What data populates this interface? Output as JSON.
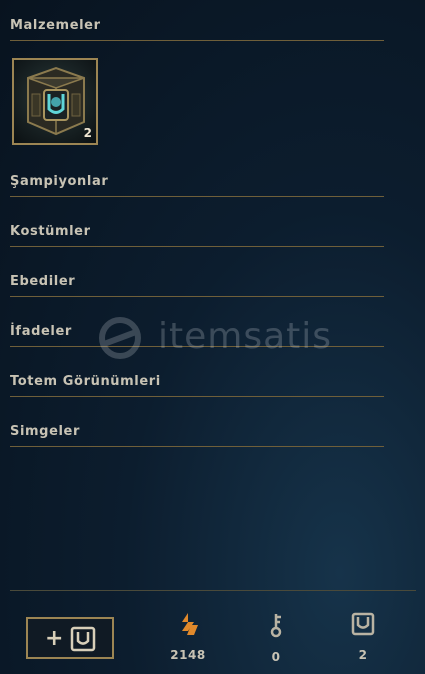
{
  "sections": {
    "materials": "Malzemeler",
    "champions": "Şampiyonlar",
    "skins": "Kostümler",
    "eternals": "Ebediler",
    "emotes": "İfadeler",
    "ward_skins": "Totem Görünümleri",
    "icons": "Simgeler"
  },
  "materials_items": [
    {
      "icon": "hextech-chest-icon",
      "count": "2"
    }
  ],
  "watermark": {
    "text": "itemsatis",
    "icon": "itemsatis-logo-icon"
  },
  "footer": {
    "add_button_plus": "+",
    "add_button_icon": "key-fragment-shield-icon",
    "currencies": [
      {
        "icon": "orange-essence-icon",
        "value": "2148",
        "color": "#e0892b"
      },
      {
        "icon": "key-icon",
        "value": "0",
        "color": "#b9b3a3"
      },
      {
        "icon": "chest-shield-icon",
        "value": "2",
        "color": "#b9b3a3"
      }
    ]
  },
  "colors": {
    "gold_border": "#9c8553",
    "divider": "#6f5f3a",
    "text": "#c8c3b4"
  }
}
